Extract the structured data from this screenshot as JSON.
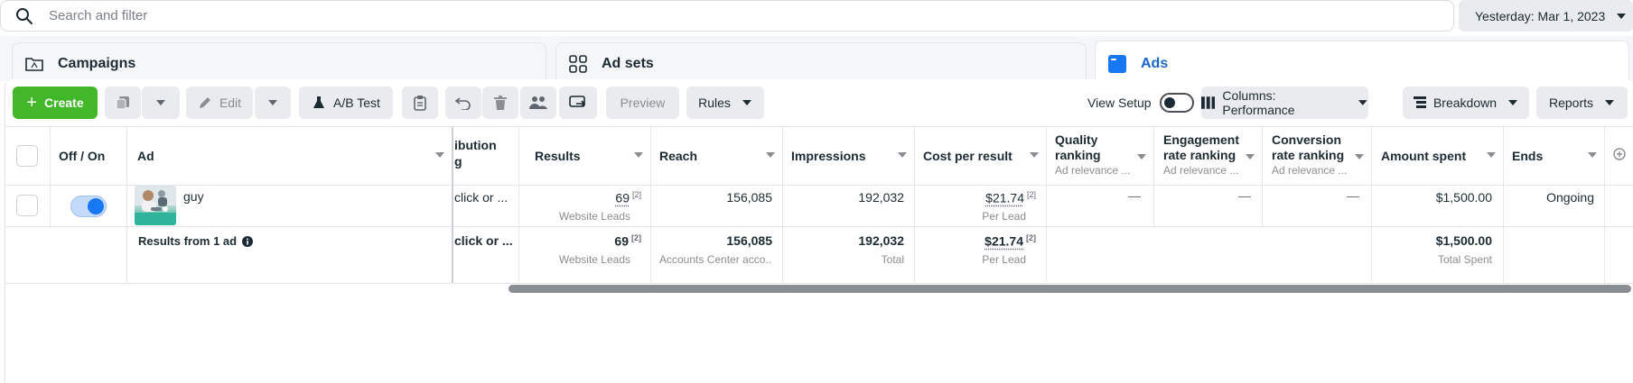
{
  "search": {
    "placeholder": "Search and filter"
  },
  "date_range": {
    "label": "Yesterday: Mar 1, 2023"
  },
  "level_tabs": {
    "campaigns": "Campaigns",
    "adsets": "Ad sets",
    "ads": "Ads"
  },
  "toolbar": {
    "create": "Create",
    "edit": "Edit",
    "ab_test": "A/B Test",
    "preview": "Preview",
    "rules": "Rules",
    "view_setup": "View Setup",
    "columns": "Columns: Performance",
    "breakdown": "Breakdown",
    "reports": "Reports"
  },
  "table": {
    "headers": {
      "off_on": "Off / On",
      "ad": "Ad",
      "attribution_line1": "ibution",
      "attribution_line2": "g",
      "results": "Results",
      "reach": "Reach",
      "impressions": "Impressions",
      "cost_per_result": "Cost per result",
      "quality_line1": "Quality",
      "quality_line2": "ranking",
      "quality_sub": "Ad relevance ...",
      "engagement_line1": "Engagement",
      "engagement_line2": "rate ranking",
      "engagement_sub": "Ad relevance ...",
      "conversion_line1": "Conversion",
      "conversion_line2": "rate ranking",
      "conversion_sub": "Ad relevance ...",
      "amount_spent": "Amount spent",
      "ends": "Ends"
    },
    "rows": [
      {
        "ad_name": "guy",
        "attribution": "click or ...",
        "results": "69",
        "results_ref": "[2]",
        "results_sub": "Website Leads",
        "reach": "156,085",
        "impressions": "192,032",
        "cost_per_result": "$21.74",
        "cost_ref": "[2]",
        "cost_sub": "Per Lead",
        "quality": "—",
        "engagement": "—",
        "conversion": "—",
        "amount_spent": "$1,500.00",
        "ends": "Ongoing"
      }
    ],
    "summary": {
      "label": "Results from 1 ad",
      "attribution": "click or ...",
      "results": "69",
      "results_ref": "[2]",
      "results_sub": "Website Leads",
      "reach": "156,085",
      "reach_sub": "Accounts Center acco...",
      "impressions": "192,032",
      "impressions_sub": "Total",
      "cost_per_result": "$21.74",
      "cost_ref": "[2]",
      "cost_sub": "Per Lead",
      "amount_spent": "$1,500.00",
      "amount_sub": "Total Spent"
    }
  },
  "colors": {
    "accent_green": "#42b72a",
    "link_blue": "#1b66c9",
    "toggle_blue": "#1877f2"
  }
}
